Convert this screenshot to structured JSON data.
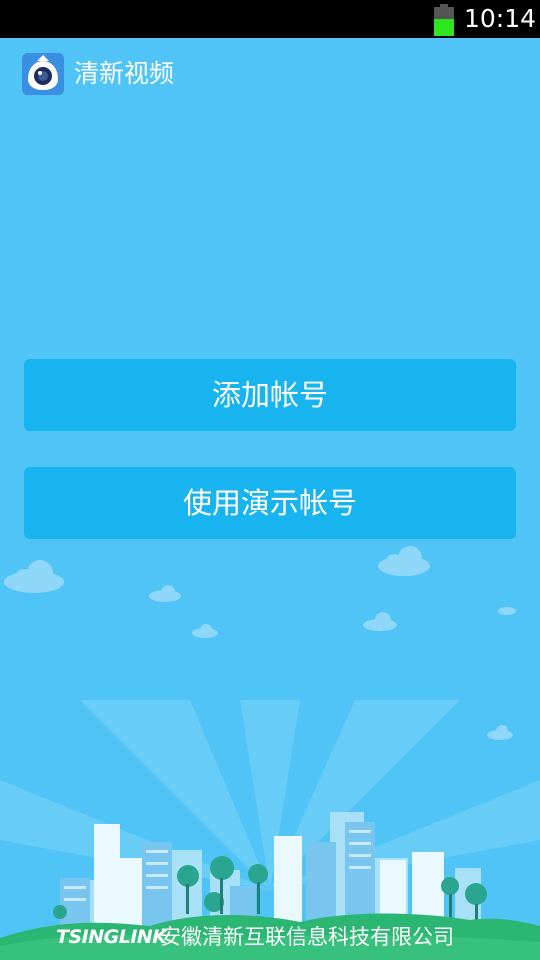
{
  "status_bar": {
    "time": "10:14",
    "battery_level": 0.6
  },
  "header": {
    "app_icon": "eye-camera-icon",
    "title": "清新视频"
  },
  "buttons": {
    "add_account": "添加帐号",
    "demo_account": "使用演示帐号"
  },
  "footer": {
    "logo": "TSINGLINK",
    "company": "安徽清新互联信息科技有限公司"
  },
  "colors": {
    "background": "#50c4f6",
    "button": "#18b4ef",
    "status_bar": "#000000",
    "battery": "#2ee61f",
    "hill": "#2bb673"
  }
}
